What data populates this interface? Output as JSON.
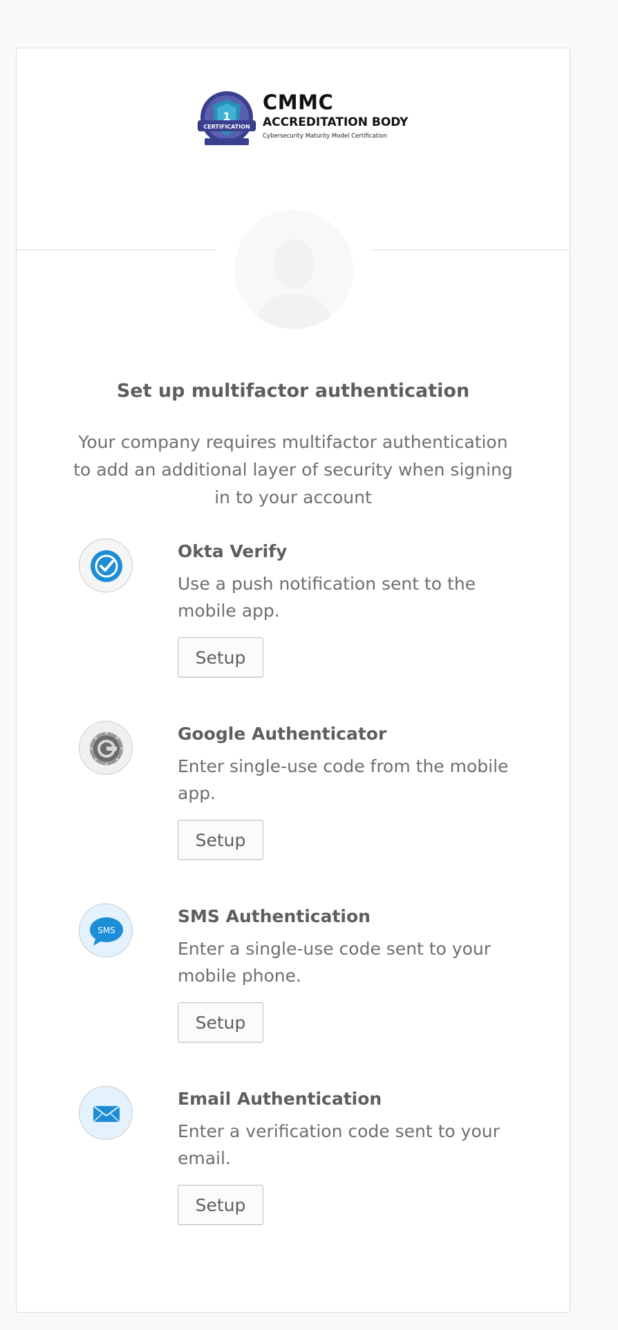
{
  "logo": {
    "title": "CMMC",
    "subtitle": "ACCREDITATION BODY",
    "tagline": "Cybersecurity Maturity Model Certification",
    "badge_text": "CERTIFICATION"
  },
  "heading": "Set up multifactor authentication",
  "intro": "Your company requires multifactor authentication to add an additional layer of security when signing in to your account",
  "factors": [
    {
      "title": "Okta Verify",
      "description": "Use a push notification sent to the mobile app.",
      "button_label": "Setup",
      "icon": "okta-verify-icon"
    },
    {
      "title": "Google Authenticator",
      "description": "Enter single-use code from the mobile app.",
      "button_label": "Setup",
      "icon": "google-authenticator-icon"
    },
    {
      "title": "SMS Authentication",
      "description": "Enter a single-use code sent to your mobile phone.",
      "button_label": "Setup",
      "icon": "sms-icon",
      "icon_text": "SMS"
    },
    {
      "title": "Email Authentication",
      "description": "Enter a verification code sent to your email.",
      "button_label": "Setup",
      "icon": "envelope-icon"
    }
  ],
  "colors": {
    "accent_blue": "#1d8dd6",
    "icon_bg_light": "#e3f2fc",
    "text": "#5e5e5e"
  }
}
